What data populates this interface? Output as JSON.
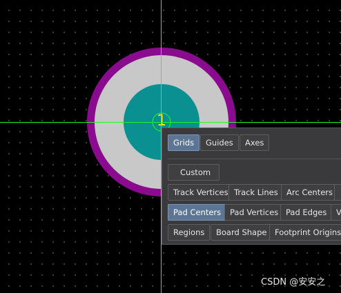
{
  "pad": {
    "designator": "1",
    "colors": {
      "solder_mask": "#8b0b8f",
      "pad_copper": "#c8c8c8",
      "hole": "#0a9090",
      "crosshair": "#20ff20",
      "label": "#f4ef2a"
    }
  },
  "snap_panel": {
    "tabs": [
      {
        "label": "Grids",
        "active": true
      },
      {
        "label": "Guides",
        "active": false
      },
      {
        "label": "Axes",
        "active": false
      }
    ],
    "custom_label": "Custom",
    "rows": [
      [
        {
          "label": "Track Vertices",
          "active": false
        },
        {
          "label": "Track Lines",
          "active": false
        },
        {
          "label": "Arc Centers",
          "active": false
        },
        {
          "label": "",
          "active": false
        }
      ],
      [
        {
          "label": "Pad Centers",
          "active": true
        },
        {
          "label": "Pad Vertices",
          "active": false
        },
        {
          "label": "Pad Edges",
          "active": false
        },
        {
          "label": "V",
          "active": false
        }
      ],
      [
        {
          "label": "Regions",
          "active": false
        },
        {
          "label": "Board Shape",
          "active": false
        },
        {
          "label": "Footprint Origins",
          "active": false
        }
      ]
    ]
  },
  "watermark": "CSDN @安安之"
}
